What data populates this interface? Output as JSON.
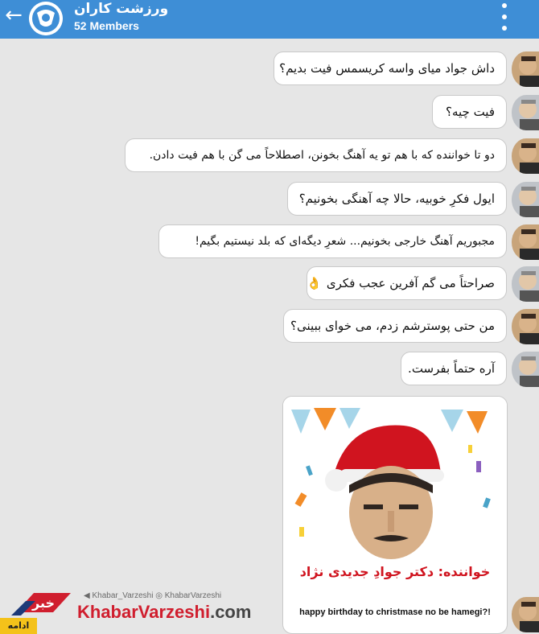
{
  "header": {
    "title": "ورزشت کاران",
    "members": "52 Members",
    "back_icon": "back-arrow-icon",
    "menu_icon": "more-vert-icon"
  },
  "messages": [
    {
      "text": "داش جواد میای واسه کریسمس فیت بدیم؟",
      "emoji": ""
    },
    {
      "text": "فیت چیه؟",
      "emoji": ""
    },
    {
      "text": "دو تا خواننده که با هم تو یه آهنگ بخونن، اصطلاحاً می گن با هم فیت دادن.",
      "emoji": ""
    },
    {
      "text": "ایول فکرِ خوبیه، حالا چه آهنگی بخونیم؟",
      "emoji": ""
    },
    {
      "text": "مجبوریم آهنگ خارجی بخونیم... شعرِ دیگه‌ای که بلد نیستیم بگیم!",
      "emoji": ""
    },
    {
      "text": "صراحتاً می گم آفرین عجب فکری",
      "emoji": "👌"
    },
    {
      "text": "من حتی پوسترشم زدم، می خوای ببینی؟",
      "emoji": ""
    },
    {
      "text": "آره حتماً بفرست.",
      "emoji": ""
    }
  ],
  "poster": {
    "caption": "خواننده: دکتر جوادِ جدیدی نژاد",
    "subtitle": "happy birthday to christmase no be hamegi?!"
  },
  "watermark": {
    "social": "◀ Khabar_Varzeshi  ◎ KhabarVarzeshi",
    "site_brand": "KhabarVarzeshi",
    "site_tld": ".com",
    "logo_text": "خبر",
    "continue": "ادامه دارد..."
  },
  "colors": {
    "header": "#3e8ed6",
    "background": "#e6e6e6",
    "brand_red": "#d01e2e",
    "badge_yellow": "#f4c21a"
  }
}
